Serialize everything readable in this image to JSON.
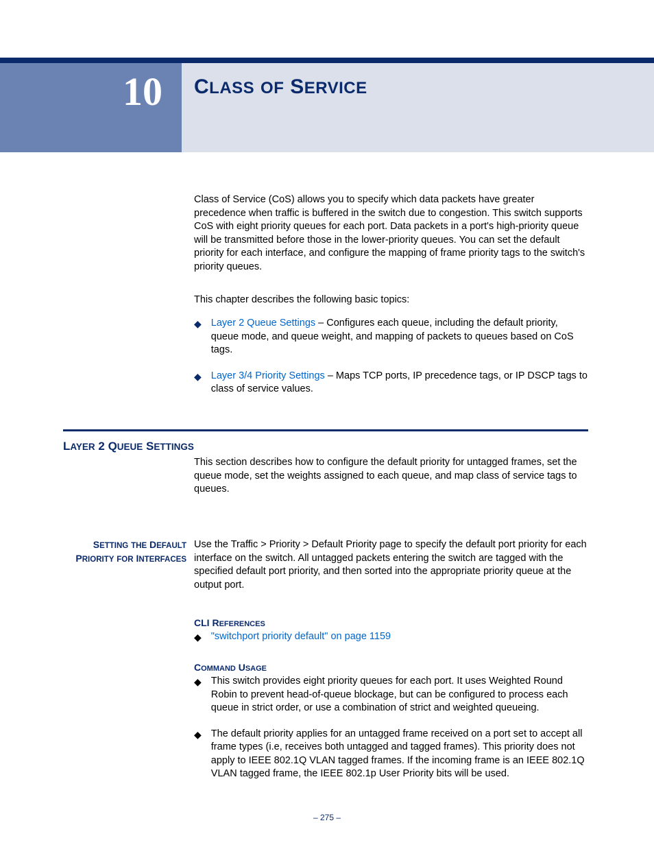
{
  "chapter": {
    "number": "10",
    "title_parts": [
      "C",
      "LASS",
      " ",
      "OF",
      " S",
      "ERVICE"
    ]
  },
  "intro": "Class of Service (CoS) allows you to specify which data packets have greater precedence when traffic is buffered in the switch due to congestion. This switch supports CoS with eight priority queues for each port. Data packets in a port's high-priority queue will be transmitted before those in the lower-priority queues. You can set the default priority for each interface, and configure the mapping of frame priority tags to the switch's priority queues.",
  "topics_intro": "This chapter describes the following basic topics:",
  "topics": [
    {
      "link": "Layer 2 Queue Settings",
      "rest": " – Configures each queue, including the default priority, queue mode, and queue weight, and mapping of packets to queues based on CoS tags."
    },
    {
      "link": "Layer 3/4 Priority Settings",
      "rest": " – Maps TCP ports, IP precedence tags, or IP DSCP tags to class of service values."
    }
  ],
  "section1": {
    "heading_parts": [
      "L",
      "AYER",
      " 2 Q",
      "UEUE",
      " S",
      "ETTINGS"
    ],
    "para": "This section describes how to configure the default priority for untagged frames, set the queue mode, set the weights assigned to each queue, and map class of service tags to queues."
  },
  "subsection1": {
    "sidebar_parts": [
      "S",
      "ETTING",
      " ",
      "THE",
      " D",
      "EFAULT",
      " P",
      "RIORITY",
      " ",
      "FOR",
      " I",
      "NTERFACES"
    ],
    "para": "Use the Traffic > Priority > Default Priority page to specify the default port priority for each interface on the switch. All untagged packets entering the switch are tagged with the specified default port priority, and then sorted into the appropriate priority queue at the output port.",
    "cli_head_parts": [
      "CLI R",
      "EFERENCES"
    ],
    "cli_link": "\"switchport priority default\" on page 1159",
    "cmd_head_parts": [
      "C",
      "OMMAND",
      " U",
      "SAGE"
    ],
    "cmd_items": [
      "This switch provides eight priority queues for each port. It uses Weighted Round Robin to prevent head-of-queue blockage, but can be configured to process each queue in strict order, or use a combination of strict and weighted queueing.",
      "The default priority applies for an untagged frame received on a port set to accept all frame types (i.e, receives both untagged and tagged frames). This priority does not apply to IEEE 802.1Q VLAN tagged frames. If the incoming frame is an IEEE 802.1Q VLAN tagged frame, the IEEE 802.1p User Priority bits will be used."
    ]
  },
  "footer": "–  275  –"
}
